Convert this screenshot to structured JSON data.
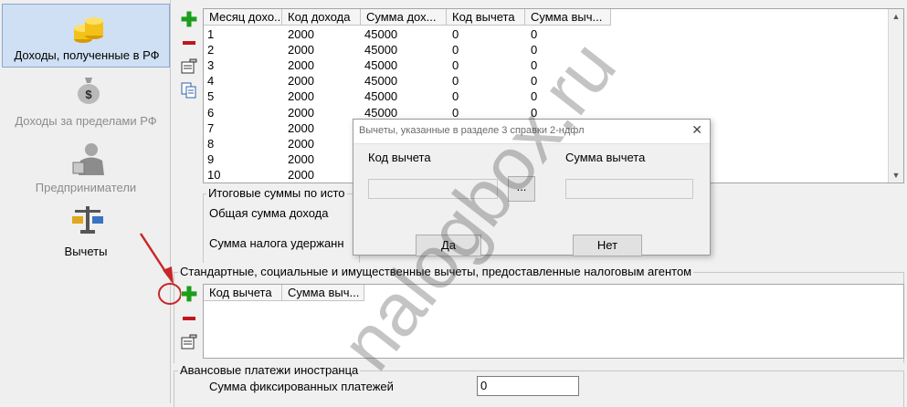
{
  "nav": {
    "items": [
      {
        "label": "Доходы, полученные в РФ",
        "icon": "coins-icon"
      },
      {
        "label": "Доходы за пределами РФ",
        "icon": "money-bag-icon"
      },
      {
        "label": "Предприниматели",
        "icon": "businessman-icon"
      },
      {
        "label": "Вычеты",
        "icon": "scales-icon"
      }
    ]
  },
  "income_table": {
    "columns": [
      "Месяц дохо...",
      "Код дохода",
      "Сумма дох...",
      "Код вычета",
      "Сумма выч..."
    ],
    "rows": [
      [
        "1",
        "2000",
        "45000",
        "0",
        "0"
      ],
      [
        "2",
        "2000",
        "45000",
        "0",
        "0"
      ],
      [
        "3",
        "2000",
        "45000",
        "0",
        "0"
      ],
      [
        "4",
        "2000",
        "45000",
        "0",
        "0"
      ],
      [
        "5",
        "2000",
        "45000",
        "0",
        "0"
      ],
      [
        "6",
        "2000",
        "45000",
        "0",
        "0"
      ],
      [
        "7",
        "2000",
        "",
        "",
        ""
      ],
      [
        "8",
        "2000",
        "",
        "",
        ""
      ],
      [
        "9",
        "2000",
        "",
        "",
        ""
      ],
      [
        "10",
        "2000",
        "",
        "",
        ""
      ]
    ]
  },
  "totals": {
    "title": "Итоговые суммы по исто",
    "total_income_label": "Общая сумма дохода",
    "tax_withheld_label": "Сумма налога удержанн"
  },
  "deductions_section": {
    "title": "Стандартные, социальные и имущественные вычеты, предоставленные налоговым агентом",
    "columns": [
      "Код вычета",
      "Сумма выч..."
    ]
  },
  "advance": {
    "title": "Авансовые платежи иностранца",
    "fixed_payments_label": "Сумма фиксированных платежей",
    "fixed_payments_value": "0"
  },
  "dialog": {
    "title": "Вычеты, указанные в разделе 3 справки 2-ндфл",
    "code_label": "Код вычета",
    "sum_label": "Сумма вычета",
    "browse_label": "...",
    "yes_label": "Да",
    "no_label": "Нет",
    "close_label": "✕"
  },
  "watermark": "nalogbox.ru",
  "colors": {
    "plus": "#1b9e1b",
    "minus": "#c0161e",
    "selection": "#cfe0f4",
    "annotation": "#c62828"
  }
}
